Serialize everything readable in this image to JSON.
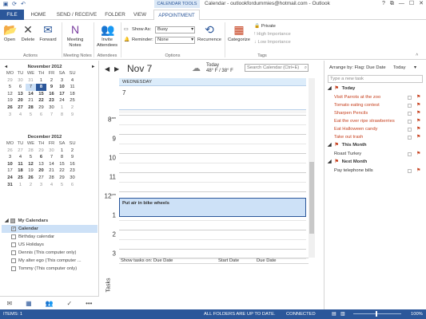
{
  "window": {
    "title": "Calendar - outlookfordummies@hotmail.com - Outlook",
    "context_header": "CALENDAR TOOLS",
    "controls": [
      "?",
      "⧉",
      "—",
      "☐",
      "✕"
    ]
  },
  "tabs": [
    {
      "label": "FILE"
    },
    {
      "label": "HOME"
    },
    {
      "label": "SEND / RECEIVE"
    },
    {
      "label": "FOLDER"
    },
    {
      "label": "VIEW"
    },
    {
      "label": "APPOINTMENT"
    }
  ],
  "ribbon": {
    "actions": {
      "open": "Open",
      "delete": "Delete",
      "forward": "Forward",
      "group": "Actions"
    },
    "meeting_notes": {
      "label": "Meeting Notes",
      "group": "Meeting Notes"
    },
    "attendees": {
      "label": "Invite Attendees",
      "group": "Attendees"
    },
    "options": {
      "show_as_label": "Show As:",
      "show_as_value": "Busy",
      "reminder_label": "Reminder:",
      "reminder_value": "None",
      "recurrence": "Recurrence",
      "group": "Options"
    },
    "tags": {
      "categorize": "Categorize",
      "private": "Private",
      "high_importance": "High Importance",
      "low_importance": "Low Importance",
      "group": "Tags"
    }
  },
  "mini_cal_1": {
    "title": "November 2012",
    "days": [
      "MO",
      "TU",
      "WE",
      "TH",
      "FR",
      "SA",
      "SU"
    ],
    "weeks": [
      [
        "29",
        "30",
        "31",
        "1",
        "2",
        "3",
        "4"
      ],
      [
        "5",
        "6",
        "7",
        "8",
        "9",
        "10",
        "11"
      ],
      [
        "12",
        "13",
        "14",
        "15",
        "16",
        "17",
        "18"
      ],
      [
        "19",
        "20",
        "21",
        "22",
        "23",
        "24",
        "25"
      ],
      [
        "26",
        "27",
        "28",
        "29",
        "30",
        "1",
        "2"
      ],
      [
        "3",
        "4",
        "5",
        "6",
        "7",
        "8",
        "9"
      ]
    ]
  },
  "mini_cal_2": {
    "title": "December 2012",
    "days": [
      "MO",
      "TU",
      "WE",
      "TH",
      "FR",
      "SA",
      "SU"
    ],
    "weeks": [
      [
        "26",
        "27",
        "28",
        "29",
        "30",
        "1",
        "2"
      ],
      [
        "3",
        "4",
        "5",
        "6",
        "7",
        "8",
        "9"
      ],
      [
        "10",
        "11",
        "12",
        "13",
        "14",
        "15",
        "16"
      ],
      [
        "17",
        "18",
        "19",
        "20",
        "21",
        "22",
        "23"
      ],
      [
        "24",
        "25",
        "26",
        "27",
        "28",
        "29",
        "30"
      ],
      [
        "31",
        "1",
        "2",
        "3",
        "4",
        "5",
        "6"
      ]
    ]
  },
  "my_calendars": {
    "header": "My Calendars",
    "items": [
      {
        "label": "Calendar",
        "checked": "✓"
      },
      {
        "label": "Birthday calendar",
        "checked": ""
      },
      {
        "label": "US Holidays",
        "checked": ""
      },
      {
        "label": "Dennis (This computer only)",
        "checked": ""
      },
      {
        "label": "My alter ego (This computer ...",
        "checked": ""
      },
      {
        "label": "Tommy (This computer only)",
        "checked": ""
      }
    ]
  },
  "calendar": {
    "date_title": "Nov 7",
    "weather_day": "Today",
    "weather_temp": "48° F / 38° F",
    "search_placeholder": "Search Calendar (Ctrl+E)",
    "day_header": "WEDNESDAY",
    "day_number": "7",
    "hours": [
      {
        "h": "8",
        "s": "am"
      },
      {
        "h": "9",
        "s": ""
      },
      {
        "h": "10",
        "s": ""
      },
      {
        "h": "11",
        "s": ""
      },
      {
        "h": "12",
        "s": "pm"
      },
      {
        "h": "1",
        "s": ""
      },
      {
        "h": "2",
        "s": ""
      },
      {
        "h": "3",
        "s": ""
      }
    ],
    "appointment": "Put air in bike wheels",
    "tasks_header": {
      "show": "Show tasks on: Due Date",
      "start": "Start Date",
      "due": "Due Date"
    },
    "tasks_label": "Tasks"
  },
  "todo": {
    "arrange": "Arrange by: Flag: Due Date",
    "arrange_value": "Today",
    "new_task_placeholder": "Type a new task",
    "groups": [
      {
        "title": "Today",
        "tasks": [
          "Visit Parrots at the zoo",
          "Tomato eating contest",
          "Sharpen Pencils",
          "Eat the over ripe strawberries",
          "Eat Halloween candy",
          "Take out trash"
        ]
      },
      {
        "title": "This Month",
        "tasks": [
          "Roast Turkey"
        ]
      },
      {
        "title": "Next Month",
        "tasks": [
          "Pay telephone bills"
        ]
      }
    ]
  },
  "nav": [
    "✉",
    "▦",
    "👥",
    "✓",
    "•••"
  ],
  "status": {
    "items": "ITEMS: 1",
    "folders": "ALL FOLDERS ARE UP TO DATE.",
    "connected": "CONNECTED",
    "zoom": "100%"
  },
  "colors": {
    "accent": "#2b579a",
    "task_red": "#c6401e",
    "appt_fill": "#cde1f7"
  }
}
